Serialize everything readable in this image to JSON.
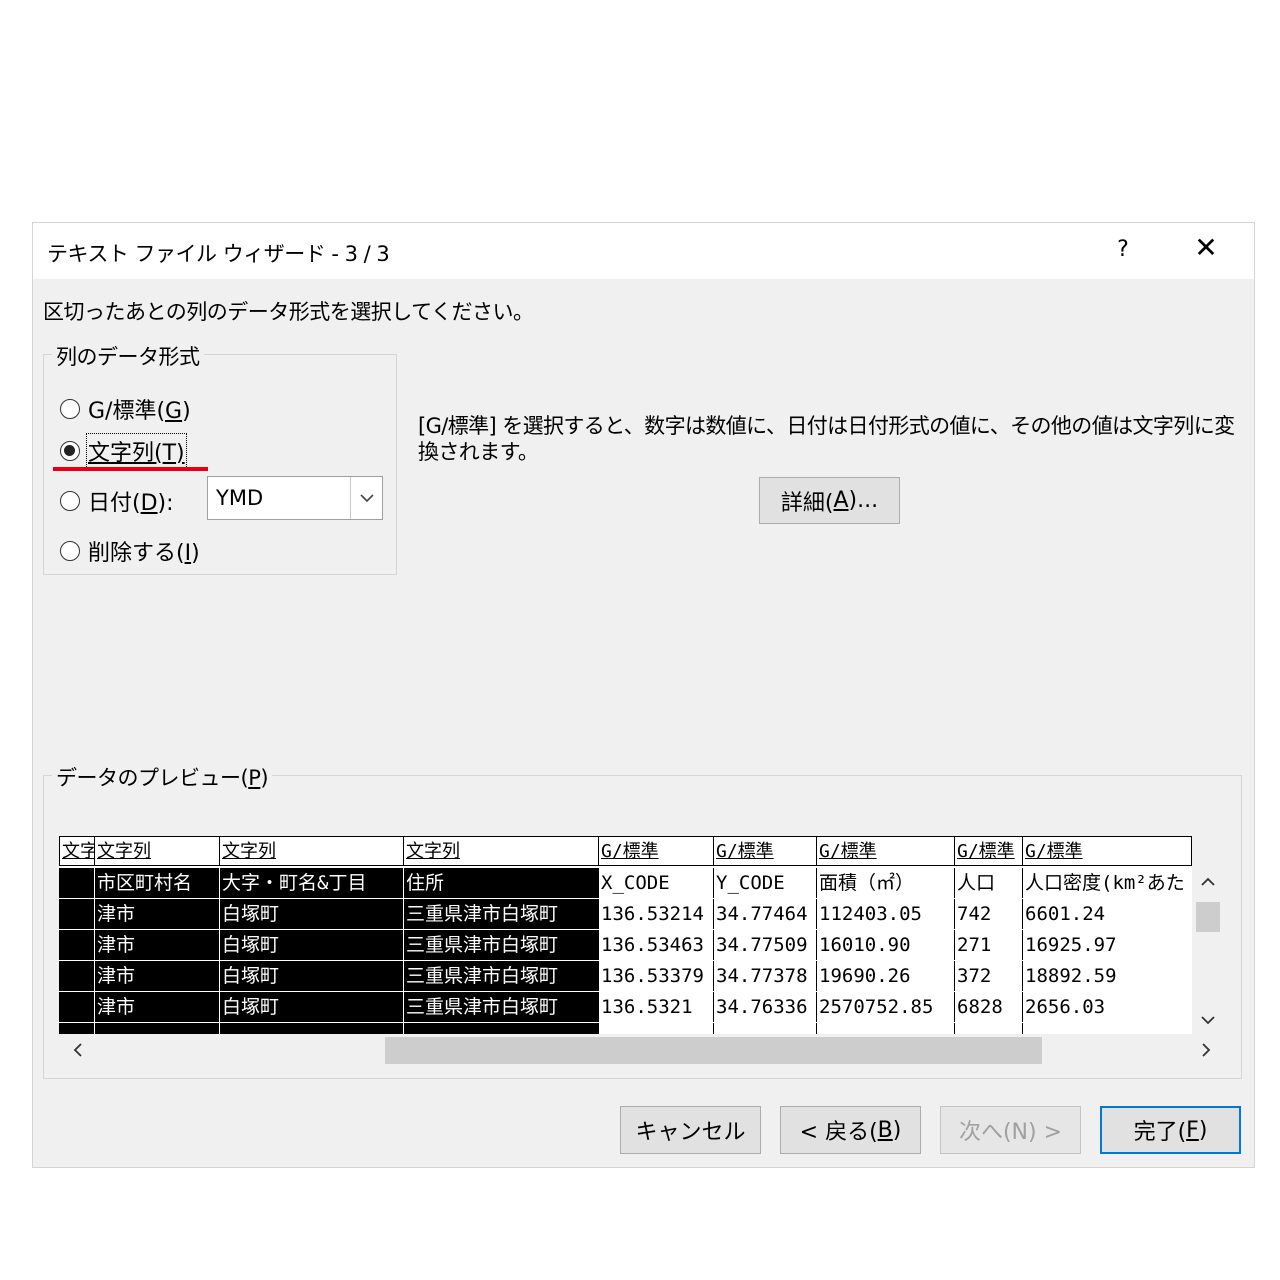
{
  "window": {
    "title": "テキスト ファイル ウィザード - 3 / 3",
    "help": "?",
    "close": "✕"
  },
  "instruction": "区切ったあとの列のデータ形式を選択してください。",
  "format_group": {
    "legend": "列のデータ形式",
    "options": [
      {
        "prefix": "G/標準(",
        "key": "G",
        "suffix": ")",
        "selected": false
      },
      {
        "prefix": "文字列(",
        "key": "T",
        "suffix": ")",
        "selected": true
      },
      {
        "prefix": "日付(",
        "key": "D",
        "suffix": "):",
        "selected": false
      },
      {
        "prefix": "削除する(",
        "key": "I",
        "suffix": ")",
        "selected": false
      }
    ],
    "date_format": "YMD"
  },
  "description": "[G/標準] を選択すると、数字は数値に、日付は日付形式の値に、その他の値は文字列に変換されます。",
  "advanced_button": {
    "prefix": "詳細(",
    "key": "A",
    "suffix": ")..."
  },
  "preview": {
    "legend_prefix": "データのプレビュー(",
    "legend_key": "P",
    "legend_suffix": ")",
    "columns": [
      {
        "header": "文字",
        "dark": true
      },
      {
        "header": "文字列",
        "dark": true
      },
      {
        "header": "文字列",
        "dark": true
      },
      {
        "header": "文字列",
        "dark": true
      },
      {
        "header": "G/標準",
        "dark": false
      },
      {
        "header": "G/標準",
        "dark": false
      },
      {
        "header": "G/標準",
        "dark": false
      },
      {
        "header": "G/標準",
        "dark": false
      },
      {
        "header": "G/標準",
        "dark": false
      }
    ],
    "rows": [
      [
        "",
        "市区町村名",
        "大字・町名&丁目",
        "住所",
        "X_CODE",
        "Y_CODE",
        "面積（㎡）",
        "人口",
        "人口密度(km²あた"
      ],
      [
        "",
        "津市",
        "白塚町",
        "三重県津市白塚町",
        "136.53214",
        "34.77464",
        "112403.05",
        "742",
        "6601.24"
      ],
      [
        "",
        "津市",
        "白塚町",
        "三重県津市白塚町",
        "136.53463",
        "34.77509",
        "16010.90",
        "271",
        "16925.97"
      ],
      [
        "",
        "津市",
        "白塚町",
        "三重県津市白塚町",
        "136.53379",
        "34.77378",
        "19690.26",
        "372",
        "18892.59"
      ],
      [
        "",
        "津市",
        "白塚町",
        "三重県津市白塚町",
        "136.5321",
        "34.76336",
        "2570752.85",
        "6828",
        "2656.03"
      ]
    ]
  },
  "buttons": {
    "cancel": "キャンセル",
    "back_prefix": "< 戻る(",
    "back_key": "B",
    "back_suffix": ")",
    "next": "次へ(N) >",
    "finish_prefix": "完了(",
    "finish_key": "F",
    "finish_suffix": ")"
  },
  "icons": {
    "scroll_up": "chevron-up-icon",
    "scroll_down": "chevron-down-icon",
    "scroll_left": "chevron-left-icon",
    "scroll_right": "chevron-right-icon",
    "combo_dropdown": "chevron-down-icon"
  },
  "colors": {
    "dialog_bg": "#f0f0f0",
    "annotation_red": "#e60012",
    "default_button_border": "#0078d7"
  }
}
